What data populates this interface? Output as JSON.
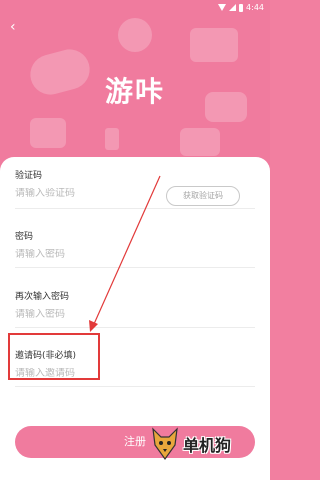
{
  "status_bar": {
    "time": "4:44"
  },
  "app": {
    "title": "游咔"
  },
  "form": {
    "verification": {
      "label": "验证码",
      "placeholder": "请输入验证码",
      "button_label": "获取验证码"
    },
    "password": {
      "label": "密码",
      "placeholder": "请输入密码"
    },
    "confirm_password": {
      "label": "再次输入密码",
      "placeholder": "请输入密码"
    },
    "invite": {
      "label": "邀请码(非必填)",
      "placeholder": "请输入邀请码"
    },
    "submit_label": "注册"
  },
  "watermark": {
    "text": "单机狗"
  },
  "colors": {
    "brand_pink": "#f07b9e",
    "annotation_red": "#e23a3a"
  },
  "icons": {
    "back": "back-chevron-icon",
    "watermark_logo": "dog-logo-icon"
  }
}
